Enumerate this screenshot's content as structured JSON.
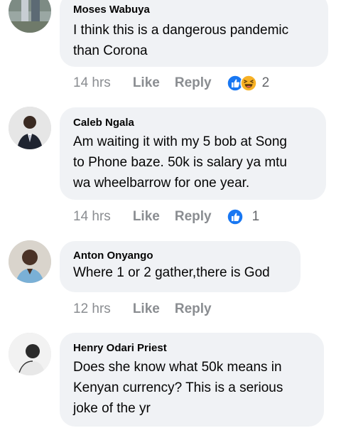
{
  "comments": [
    {
      "author": "Moses Wabuya",
      "text_lines": [
        "I think this is a dangerous pandemic",
        "than Corona"
      ],
      "time": "14 hrs",
      "like_label": "Like",
      "reply_label": "Reply",
      "reaction_icons": [
        "like-icon",
        "haha-icon"
      ],
      "reaction_count": "2"
    },
    {
      "author": "Caleb Ngala",
      "text_lines": [
        "Am waiting it with my 5 bob at Song",
        "to Phone baze. 50k is salary ya mtu",
        "wa wheelbarrow for one year."
      ],
      "time": "14 hrs",
      "like_label": "Like",
      "reply_label": "Reply",
      "reaction_icons": [
        "like-icon"
      ],
      "reaction_count": "1"
    },
    {
      "author": "Anton Onyango",
      "text_lines": [
        "Where 1 or 2 gather,there is God"
      ],
      "time": "12 hrs",
      "like_label": "Like",
      "reply_label": "Reply"
    },
    {
      "author": "Henry Odari Priest",
      "text_lines": [
        "Does she know what 50k means in",
        "Kenyan currency? This is a serious",
        "joke of the yr"
      ]
    }
  ],
  "colors": {
    "bubble": "#f0f2f5",
    "meta_text": "#8a8d91",
    "like_blue": "#1877f2",
    "haha_yellow": "#f7b125"
  }
}
